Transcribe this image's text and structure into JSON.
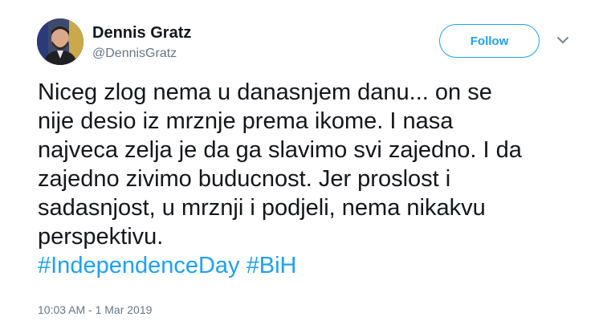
{
  "author": {
    "name": "Dennis Gratz",
    "handle": "@DennisGratz"
  },
  "follow_button": {
    "label": "Follow"
  },
  "menu": {
    "icon": "chevron-down-icon"
  },
  "tweet": {
    "lines": [
      "Niceg zlog nema u danasnjem danu... on se",
      "nije desio iz mrznje prema ikome. I nasa",
      "najveca zelja je da ga slavimo svi zajedno. I da",
      "zajedno zivimo buducnost. Jer proslost i",
      "sadasnjost, u mrznji i podjeli, nema nikakvu",
      "perspektivu."
    ],
    "hashtags": [
      "#IndependenceDay",
      "#BiH"
    ],
    "timestamp": "10:03 AM - 1 Mar 2019"
  },
  "colors": {
    "accent": "#1da1f2",
    "text": "#14171a",
    "secondary": "#657786"
  }
}
